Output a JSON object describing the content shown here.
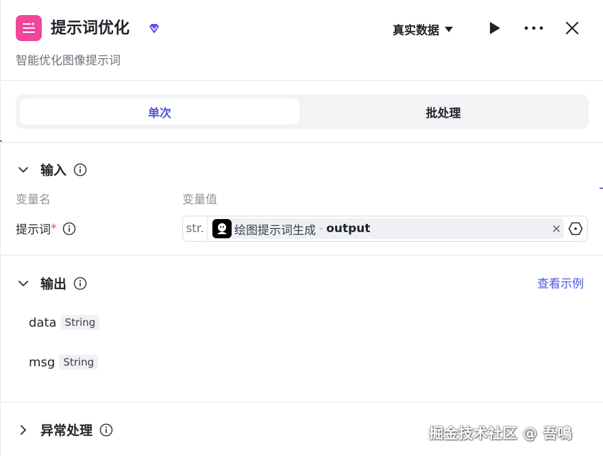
{
  "header": {
    "title": "提示词优化",
    "subtitle": "智能优化图像提示词",
    "data_mode": "真实数据",
    "accent": "#4e55e3",
    "icon_color": "#f0479a"
  },
  "mode_tabs": [
    {
      "label": "单次",
      "active": true
    },
    {
      "label": "批处理",
      "active": false
    }
  ],
  "input": {
    "title": "输入",
    "col_name": "变量名",
    "col_value": "变量值",
    "variables": [
      {
        "name": "提示词",
        "required_mark": "*",
        "type": "str.",
        "ref_node": "绘图提示词生成",
        "ref_sep": "-",
        "ref_output": "output"
      }
    ]
  },
  "output": {
    "title": "输出",
    "view_example": "查看示例",
    "fields": [
      {
        "name": "data",
        "type": "String"
      },
      {
        "name": "msg",
        "type": "String"
      }
    ]
  },
  "error_handling": {
    "title": "异常处理"
  },
  "watermark": "掘金技术社区 @ 吾鳴"
}
